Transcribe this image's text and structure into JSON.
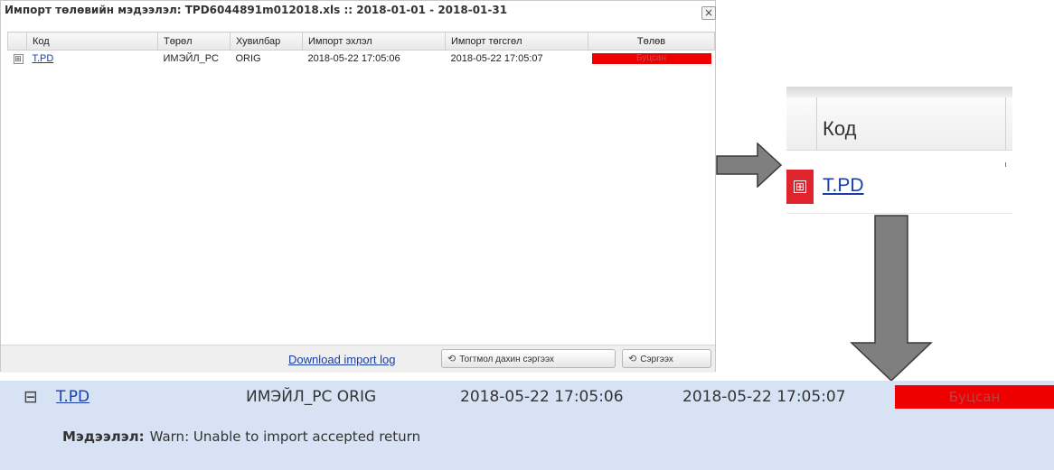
{
  "dialog": {
    "title": "Импорт төлөвийн мэдээлэл: TPD6044891m012018.xls :: 2018-01-01 - 2018-01-31",
    "close_label": "×",
    "columns": [
      "Код",
      "Төрөл",
      "Хувилбар",
      "Импорт эхлэл",
      "Импорт төгсгөл",
      "Төлөв"
    ],
    "row": {
      "expander": "⊞",
      "code": "T.PD",
      "type": "ИМЭЙЛ_PC",
      "version": "ORIG",
      "start": "2018-05-22 17:05:06",
      "end": "2018-05-22 17:05:07",
      "status": "Буцсан",
      "status_color": "#ee0000"
    },
    "footer": {
      "download_link": "Download import log",
      "retry_all_button": "Тогтмол дахин сэргээх",
      "retry_button": "Сэргээх",
      "refresh_icon": "refresh-icon"
    }
  },
  "zoom": {
    "header_label": "Код",
    "expander": "⊞",
    "code": "T.PD",
    "highlight_color": "#e0242e"
  },
  "expanded": {
    "collapse": "⊟",
    "code": "T.PD",
    "type_version": "ИМЭЙЛ_PC ORIG",
    "start": "2018-05-22 17:05:06",
    "end": "2018-05-22 17:05:07",
    "status": "Буцсан",
    "message_label": "Мэдээлэл:",
    "message_text": "Warn: Unable to import accepted return",
    "background": "#d7e3f5"
  }
}
